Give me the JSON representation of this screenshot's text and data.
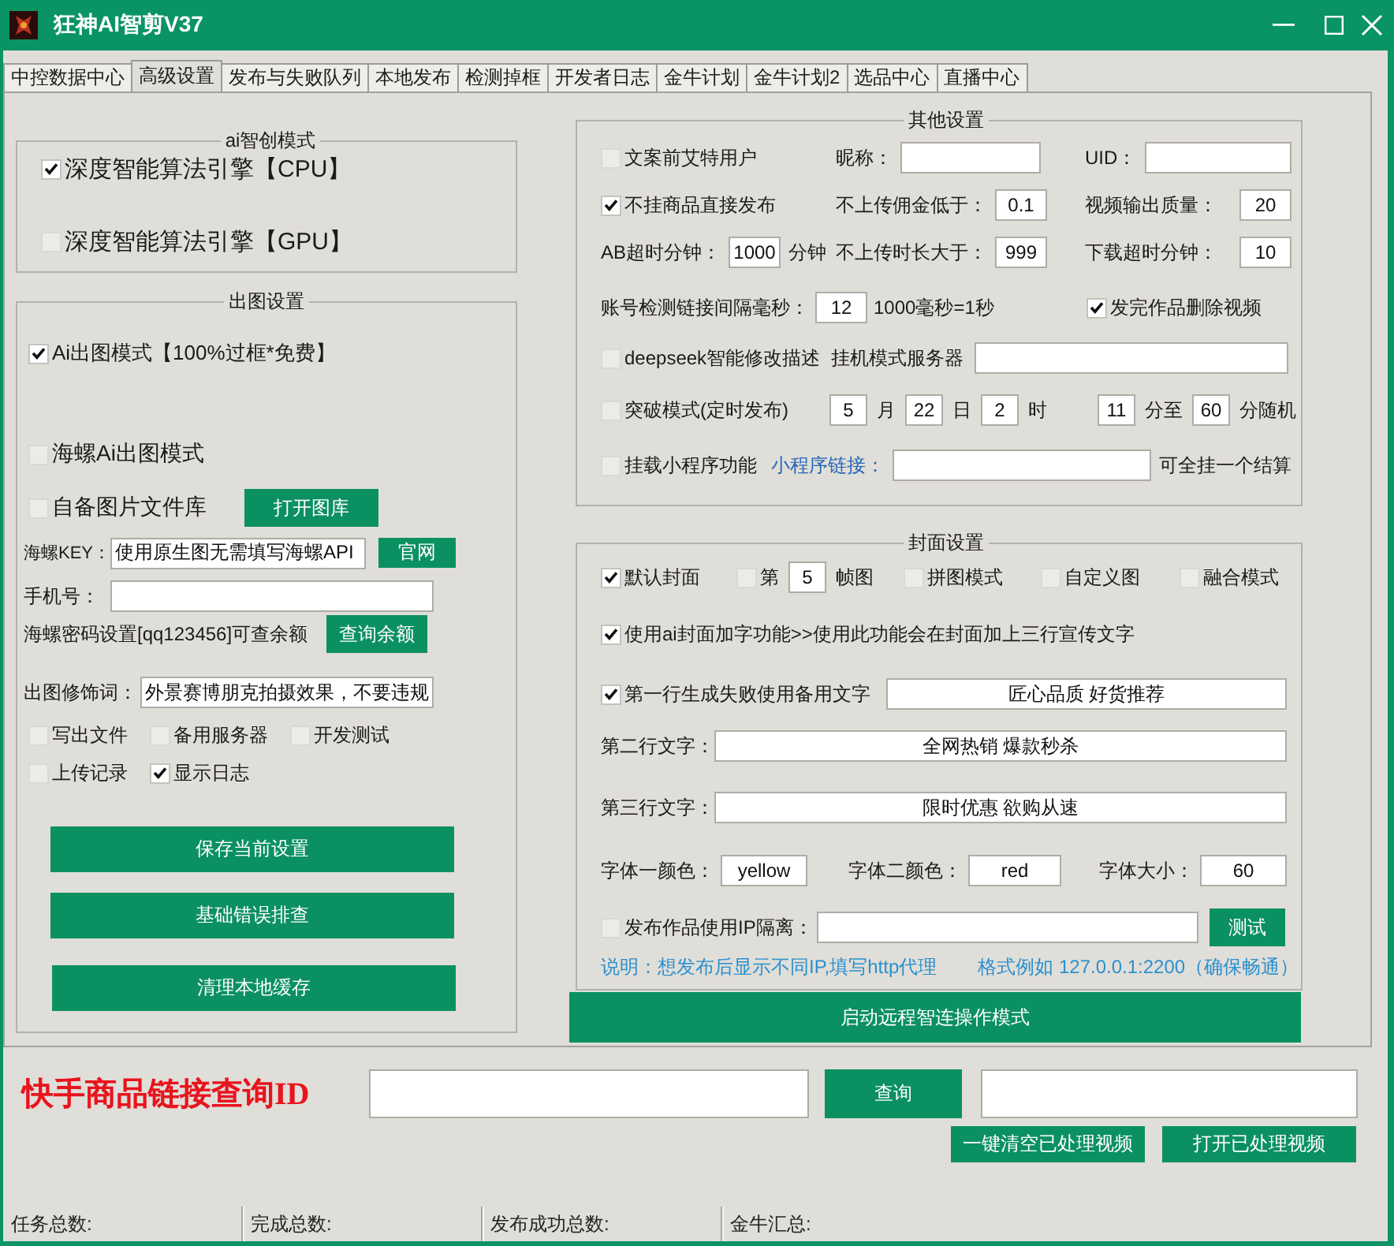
{
  "window": {
    "title": "狂神AI智剪V37"
  },
  "tabs": [
    {
      "label": "中控数据中心",
      "selected": false
    },
    {
      "label": "高级设置",
      "selected": true
    },
    {
      "label": "发布与失败队列",
      "selected": false
    },
    {
      "label": "本地发布",
      "selected": false
    },
    {
      "label": "检测掉框",
      "selected": false
    },
    {
      "label": "开发者日志",
      "selected": false
    },
    {
      "label": "金牛计划",
      "selected": false
    },
    {
      "label": "金牛计划2",
      "selected": false
    },
    {
      "label": "选品中心",
      "selected": false
    },
    {
      "label": "直播中心",
      "selected": false
    }
  ],
  "ai_mode": {
    "title": "ai智创模式",
    "options": [
      {
        "label": "深度智能算法引擎【CPU】",
        "checked": true
      },
      {
        "label": "深度智能算法引擎【GPU】",
        "checked": false
      }
    ]
  },
  "image_settings": {
    "title": "出图设置",
    "ai_mode": {
      "label": "Ai出图模式【100%过框*免费】",
      "checked": true
    },
    "hailuo_mode": {
      "label": "海螺Ai出图模式",
      "checked": false
    },
    "own_library": {
      "label": "自备图片文件库",
      "checked": false,
      "button": "打开图库"
    },
    "key": {
      "label": "海螺KEY：",
      "value": "使用原生图无需填写海螺API",
      "button": "官网"
    },
    "phone": {
      "label": "手机号："
    },
    "balance": {
      "note": "海螺密码设置[qq123456]可查余额",
      "button": "查询余额"
    },
    "prompt": {
      "label": "出图修饰词：",
      "value": "外景赛博朋克拍摄效果，不要违规"
    },
    "option_rows": [
      [
        {
          "label": "写出文件",
          "checked": false
        },
        {
          "label": "备用服务器",
          "checked": false
        },
        {
          "label": "开发测试",
          "checked": false
        }
      ],
      [
        {
          "label": "上传记录",
          "checked": false
        },
        {
          "label": "显示日志",
          "checked": true
        }
      ]
    ],
    "buttons": [
      "保存当前设置",
      "基础错误排查",
      "清理本地缓存"
    ]
  },
  "other_settings": {
    "title": "其他设置",
    "rows": [
      {
        "items": [
          {
            "kind": "checkbox",
            "label": "文案前艾特用户",
            "checked": false
          },
          {
            "kind": "label",
            "text": "昵称："
          },
          {
            "kind": "field"
          },
          {
            "kind": "label",
            "text": "UID："
          },
          {
            "kind": "field"
          }
        ]
      },
      {
        "items": [
          {
            "kind": "checkbox",
            "label": "不挂商品直接发布",
            "checked": true
          },
          {
            "kind": "label",
            "text": "不上传佣金低于："
          },
          {
            "kind": "number",
            "value": "0.1"
          },
          {
            "kind": "label",
            "text": "视频输出质量："
          },
          {
            "kind": "number",
            "value": "20"
          }
        ]
      },
      {
        "items": [
          {
            "kind": "label",
            "text": "AB超时分钟："
          },
          {
            "kind": "number",
            "value": "1000"
          },
          {
            "kind": "label",
            "text": "分钟"
          },
          {
            "kind": "label",
            "text": "不上传时长大于："
          },
          {
            "kind": "number",
            "value": "999"
          },
          {
            "kind": "label",
            "text": "下载超时分钟："
          },
          {
            "kind": "number",
            "value": "10"
          }
        ]
      },
      {
        "items": [
          {
            "kind": "label",
            "text": "账号检测链接间隔毫秒："
          },
          {
            "kind": "number",
            "value": "12"
          },
          {
            "kind": "label",
            "text": "1000毫秒=1秒"
          },
          {
            "kind": "checkbox",
            "label": "发完作品删除视频",
            "checked": true
          }
        ]
      },
      {
        "items": [
          {
            "kind": "checkbox",
            "label": "deepseek智能修改描述",
            "checked": false
          },
          {
            "kind": "label",
            "text": "挂机模式服务器"
          },
          {
            "kind": "field"
          }
        ]
      },
      {
        "items": [
          {
            "kind": "checkbox",
            "label": "突破模式(定时发布)",
            "checked": false
          },
          {
            "kind": "number",
            "value": "5"
          },
          {
            "kind": "label",
            "text": "月"
          },
          {
            "kind": "number",
            "value": "22"
          },
          {
            "kind": "label",
            "text": "日"
          },
          {
            "kind": "number",
            "value": "2"
          },
          {
            "kind": "label",
            "text": "时"
          },
          {
            "kind": "number",
            "value": "11"
          },
          {
            "kind": "label",
            "text": "分至"
          },
          {
            "kind": "number",
            "value": "60"
          },
          {
            "kind": "label",
            "text": "分随机"
          }
        ]
      },
      {
        "items": [
          {
            "kind": "checkbox",
            "label": "挂载小程序功能",
            "checked": false
          },
          {
            "kind": "link",
            "text": "小程序链接："
          },
          {
            "kind": "field"
          },
          {
            "kind": "label",
            "text": "可全挂一个结算"
          }
        ]
      }
    ]
  },
  "cover_settings": {
    "title": "封面设置",
    "rows": [
      {
        "items": [
          {
            "kind": "checkbox",
            "label": "默认封面",
            "checked": true
          },
          {
            "kind": "checkbox",
            "label": "第",
            "checked": false
          },
          {
            "kind": "number",
            "value": "5"
          },
          {
            "kind": "label",
            "text": "帧图"
          },
          {
            "kind": "checkbox",
            "label": "拼图模式",
            "checked": false
          },
          {
            "kind": "checkbox",
            "label": "自定义图",
            "checked": false
          },
          {
            "kind": "checkbox",
            "label": "融合模式",
            "checked": false
          }
        ]
      },
      {
        "items": [
          {
            "kind": "checkbox",
            "label": "使用ai封面加字功能>>使用此功能会在封面加上三行宣传文字",
            "checked": true
          }
        ]
      },
      {
        "items": [
          {
            "kind": "checkbox",
            "label": "第一行生成失败使用备用文字",
            "checked": true
          },
          {
            "kind": "field",
            "value": "匠心品质 好货推荐"
          }
        ]
      },
      {
        "items": [
          {
            "kind": "label",
            "text": "第二行文字："
          },
          {
            "kind": "field",
            "value": "全网热销 爆款秒杀"
          }
        ]
      },
      {
        "items": [
          {
            "kind": "label",
            "text": "第三行文字："
          },
          {
            "kind": "field",
            "value": "限时优惠 欲购从速"
          }
        ]
      },
      {
        "items": [
          {
            "kind": "label",
            "text": "字体一颜色："
          },
          {
            "kind": "field",
            "value": "yellow"
          },
          {
            "kind": "label",
            "text": "字体二颜色："
          },
          {
            "kind": "field",
            "value": "red"
          },
          {
            "kind": "label",
            "text": "字体大小："
          },
          {
            "kind": "field",
            "value": "60"
          }
        ]
      },
      {
        "items": [
          {
            "kind": "checkbox",
            "label": "发布作品使用IP隔离：",
            "checked": false
          },
          {
            "kind": "field"
          },
          {
            "kind": "button",
            "label": "测试"
          }
        ]
      },
      {
        "items": [
          {
            "kind": "note",
            "text": "说明：想发布后显示不同IP,填写http代理"
          },
          {
            "kind": "note",
            "text": "格式例如 127.0.0.1:2200（确保畅通）"
          }
        ]
      }
    ]
  },
  "remote_button": "启动远程智连操作模式",
  "query": {
    "label": "快手商品链接查询ID",
    "button": "查询"
  },
  "actions": [
    "一键清空已处理视频",
    "打开已处理视频"
  ],
  "status_bar": [
    "任务总数:",
    "完成总数:",
    "发布成功总数:",
    "金牛汇总:"
  ]
}
